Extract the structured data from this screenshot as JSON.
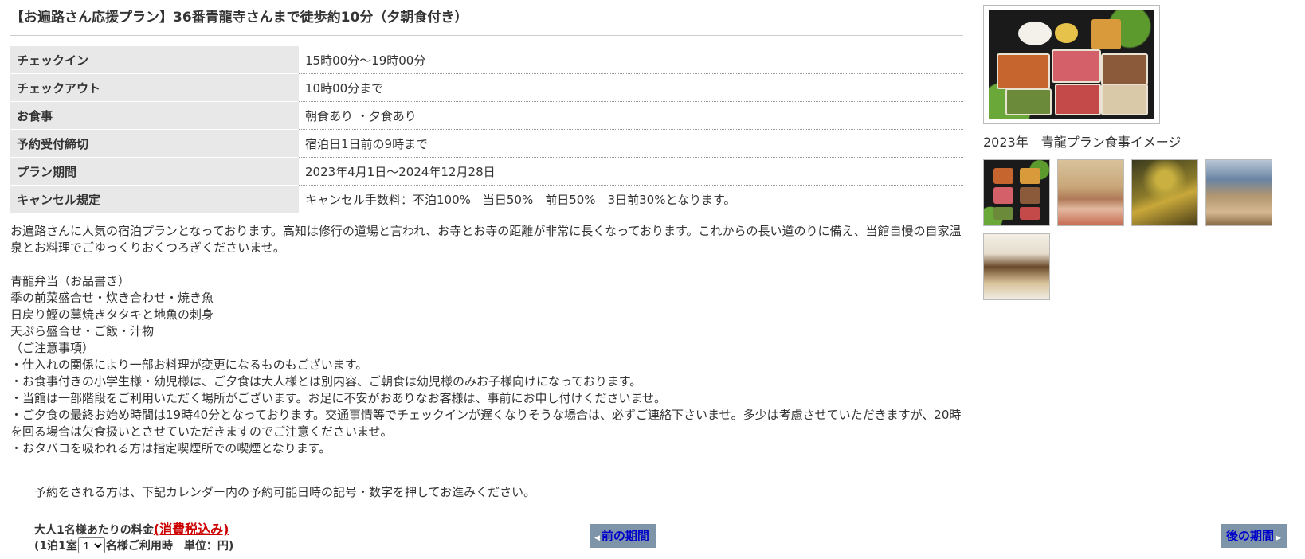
{
  "plan": {
    "title": "【お遍路さん応援プラン】36番青龍寺さんまで徒歩約10分（夕朝食付き）"
  },
  "info_rows": [
    {
      "label": "チェックイン",
      "value": "15時00分～19時00分"
    },
    {
      "label": "チェックアウト",
      "value": "10時00分まで"
    },
    {
      "label": "お食事",
      "value": "朝食あり ・夕食あり"
    },
    {
      "label": "予約受付締切",
      "value": "宿泊日1日前の9時まで"
    },
    {
      "label": "プラン期間",
      "value": "2023年4月1日～2024年12月28日"
    },
    {
      "label": "キャンセル規定",
      "value": "キャンセル手数料：不泊100%　当日50%　前日50%　3日前30%となります。"
    }
  ],
  "description": {
    "intro": "お遍路さんに人気の宿泊プランとなっております。高知は修行の道場と言われ、お寺とお寺の距離が非常に長くなっております。これからの長い道のりに備え、当館自慢の自家温泉とお料理でごゆっくりおくつろぎくださいませ。",
    "menu_title": "青龍弁当（お品書き）",
    "menu_1": "季の前菜盛合せ・炊き合わせ・焼き魚",
    "menu_2": "日戻り鰹の藁焼きタタキと地魚の刺身",
    "menu_3": "天ぷら盛合せ・ご飯・汁物",
    "notes_title": "（ご注意事項）",
    "note_1": "・仕入れの関係により一部お料理が変更になるものもございます。",
    "note_2": "・お食事付きの小学生様・幼児様は、ご夕食は大人様とは別内容、ご朝食は幼児様のみお子様向けになっております。",
    "note_3": "・当館は一部階段をご利用いただく場所がございます。お足に不安がおありなお客様は、事前にお申し付けくださいませ。",
    "note_4": "・ご夕食の最終お始め時間は19時40分となっております。交通事情等でチェックインが遅くなりそうな場合は、必ずご連絡下さいませ。多少は考慮させていただきますが、20時を回る場合は欠食扱いとさせていただきますのでご注意くださいませ。",
    "note_5": "・おタバコを吸われる方は指定喫煙所での喫煙となります。"
  },
  "reserve": {
    "instruction": "予約をされる方は、下記カレンダー内の予約可能日時の記号・数字を押してお進みください。",
    "price_prefix": "大人1名様あたりの料金",
    "tax_link": "(消費税込み)",
    "room_prefix": "(1泊1室",
    "room_select_value": "1",
    "room_suffix": "名様ご利用時　単位：円)"
  },
  "nav": {
    "prev_label": "前の期間",
    "next_label": "後の期間"
  },
  "gallery": {
    "caption": "2023年　青龍プラン食事イメージ"
  },
  "colors": {
    "label_bg": "#e8e8e8",
    "nav_bg": "#7e94a8",
    "link_blue": "#0000cc",
    "tax_red": "#cc0000"
  }
}
